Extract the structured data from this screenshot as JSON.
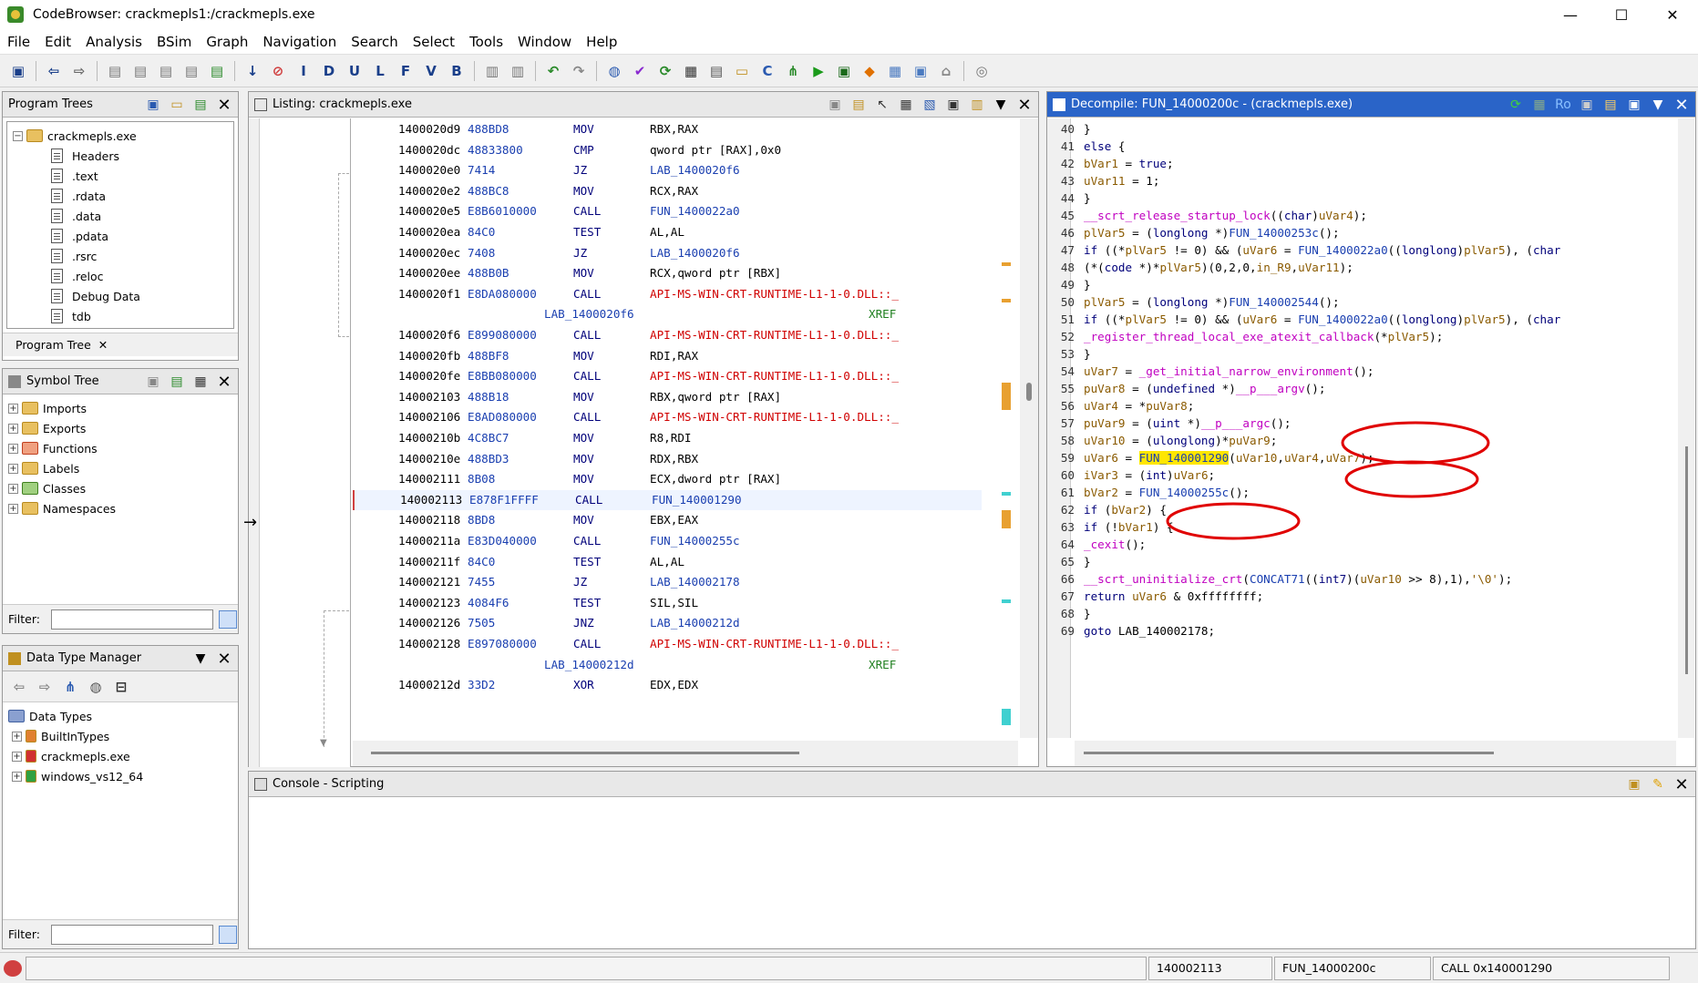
{
  "window": {
    "title": "CodeBrowser: crackmepls1:/crackmepls.exe",
    "controls": [
      "—",
      "☐",
      "✕"
    ]
  },
  "menu": [
    "File",
    "Edit",
    "Analysis",
    "BSim",
    "Graph",
    "Navigation",
    "Search",
    "Select",
    "Tools",
    "Window",
    "Help"
  ],
  "program_trees": {
    "title": "Program Trees",
    "root": "crackmepls.exe",
    "items": [
      "Headers",
      ".text",
      ".rdata",
      ".data",
      ".pdata",
      ".rsrc",
      ".reloc",
      "Debug Data",
      "tdb"
    ],
    "tab": "Program Tree"
  },
  "symbol_tree": {
    "title": "Symbol Tree",
    "items": [
      "Imports",
      "Exports",
      "Functions",
      "Labels",
      "Classes",
      "Namespaces"
    ],
    "filter_label": "Filter:"
  },
  "data_type_manager": {
    "title": "Data Type Manager",
    "root": "Data Types",
    "items": [
      "BuiltInTypes",
      "crackmepls.exe",
      "windows_vs12_64"
    ],
    "filter_label": "Filter:"
  },
  "listing": {
    "title": "Listing:  crackmepls.exe",
    "rows": [
      {
        "addr": "1400020d9",
        "bytes": "488BD8",
        "mn": "MOV",
        "op": "RBX,RAX",
        "opk": "op"
      },
      {
        "addr": "1400020dc",
        "bytes": "48833800",
        "mn": "CMP",
        "op": "qword ptr [RAX],0x0",
        "opk": "op"
      },
      {
        "addr": "1400020e0",
        "bytes": "7414",
        "mn": "JZ",
        "op": "LAB_1400020f6",
        "opk": "lab"
      },
      {
        "addr": "1400020e2",
        "bytes": "488BC8",
        "mn": "MOV",
        "op": "RCX,RAX",
        "opk": "op"
      },
      {
        "addr": "1400020e5",
        "bytes": "E8B6010000",
        "mn": "CALL",
        "op": "FUN_1400022a0",
        "opk": "lab"
      },
      {
        "addr": "1400020ea",
        "bytes": "84C0",
        "mn": "TEST",
        "op": "AL,AL",
        "opk": "op"
      },
      {
        "addr": "1400020ec",
        "bytes": "7408",
        "mn": "JZ",
        "op": "LAB_1400020f6",
        "opk": "lab"
      },
      {
        "addr": "1400020ee",
        "bytes": "488B0B",
        "mn": "MOV",
        "op": "RCX,qword ptr [RBX]",
        "opk": "op"
      },
      {
        "addr": "1400020f1",
        "bytes": "E8DA080000",
        "mn": "CALL",
        "op": "API-MS-WIN-CRT-RUNTIME-L1-1-0.DLL::_",
        "opk": "api"
      },
      {
        "label": "LAB_1400020f6",
        "xref": "XREF"
      },
      {
        "addr": "1400020f6",
        "bytes": "E899080000",
        "mn": "CALL",
        "op": "API-MS-WIN-CRT-RUNTIME-L1-1-0.DLL::_",
        "opk": "api"
      },
      {
        "addr": "1400020fb",
        "bytes": "488BF8",
        "mn": "MOV",
        "op": "RDI,RAX",
        "opk": "op"
      },
      {
        "addr": "1400020fe",
        "bytes": "E8BB080000",
        "mn": "CALL",
        "op": "API-MS-WIN-CRT-RUNTIME-L1-1-0.DLL::_",
        "opk": "api"
      },
      {
        "addr": "140002103",
        "bytes": "488B18",
        "mn": "MOV",
        "op": "RBX,qword ptr [RAX]",
        "opk": "op"
      },
      {
        "addr": "140002106",
        "bytes": "E8AD080000",
        "mn": "CALL",
        "op": "API-MS-WIN-CRT-RUNTIME-L1-1-0.DLL::_",
        "opk": "api"
      },
      {
        "addr": "14000210b",
        "bytes": "4C8BC7",
        "mn": "MOV",
        "op": "R8,RDI",
        "opk": "op"
      },
      {
        "addr": "14000210e",
        "bytes": "488BD3",
        "mn": "MOV",
        "op": "RDX,RBX",
        "opk": "op"
      },
      {
        "addr": "140002111",
        "bytes": "8B08",
        "mn": "MOV",
        "op": "ECX,dword ptr [RAX]",
        "opk": "op"
      },
      {
        "addr": "140002113",
        "bytes": "E878F1FFFF",
        "mn": "CALL",
        "op": "FUN_140001290",
        "opk": "lab",
        "current": true
      },
      {
        "addr": "140002118",
        "bytes": "8BD8",
        "mn": "MOV",
        "op": "EBX,EAX",
        "opk": "op"
      },
      {
        "addr": "14000211a",
        "bytes": "E83D040000",
        "mn": "CALL",
        "op": "FUN_14000255c",
        "opk": "lab"
      },
      {
        "addr": "14000211f",
        "bytes": "84C0",
        "mn": "TEST",
        "op": "AL,AL",
        "opk": "op"
      },
      {
        "addr": "140002121",
        "bytes": "7455",
        "mn": "JZ",
        "op": "LAB_140002178",
        "opk": "lab"
      },
      {
        "addr": "140002123",
        "bytes": "4084F6",
        "mn": "TEST",
        "op": "SIL,SIL",
        "opk": "op"
      },
      {
        "addr": "140002126",
        "bytes": "7505",
        "mn": "JNZ",
        "op": "LAB_14000212d",
        "opk": "lab"
      },
      {
        "addr": "140002128",
        "bytes": "E897080000",
        "mn": "CALL",
        "op": "API-MS-WIN-CRT-RUNTIME-L1-1-0.DLL::_",
        "opk": "api"
      },
      {
        "label": "LAB_14000212d",
        "xref": "XREF"
      },
      {
        "addr": "14000212d",
        "bytes": "33D2",
        "mn": "XOR",
        "op": "EDX,EDX",
        "opk": "op"
      }
    ]
  },
  "decompile": {
    "title": "Decompile: FUN_14000200c -  (crackmepls.exe)",
    "lines": [
      {
        "n": "40",
        "html": "  }"
      },
      {
        "n": "41",
        "html": "  <span class='k'>else</span> {"
      },
      {
        "n": "42",
        "html": "    <span class='v'>bVar1</span> = <span class='k'>true</span>;"
      },
      {
        "n": "43",
        "html": "    <span class='v'>uVar11</span> = 1;"
      },
      {
        "n": "44",
        "html": "  }"
      },
      {
        "n": "45",
        "html": "  <span class='fm'>__scrt_release_startup_lock</span>((<span class='t'>char</span>)<span class='v'>uVar4</span>);"
      },
      {
        "n": "46",
        "html": "  <span class='v'>plVar5</span> = (<span class='t'>longlong</span> *)<span class='f'>FUN_14000253c</span>();"
      },
      {
        "n": "47",
        "html": "  <span class='k'>if</span> ((*<span class='v'>plVar5</span> != 0) &amp;&amp; (<span class='v'>uVar6</span> = <span class='f'>FUN_1400022a0</span>((<span class='t'>longlong</span>)<span class='v'>plVar5</span>), (<span class='t'>char</span>"
      },
      {
        "n": "48",
        "html": "    (*(<span class='t'>code</span> *)*<span class='v'>plVar5</span>)(0,2,0,<span class='v'>in_R9</span>,<span class='v'>uVar11</span>);"
      },
      {
        "n": "49",
        "html": "  }"
      },
      {
        "n": "50",
        "html": "  <span class='v'>plVar5</span> = (<span class='t'>longlong</span> *)<span class='f'>FUN_140002544</span>();"
      },
      {
        "n": "51",
        "html": "  <span class='k'>if</span> ((*<span class='v'>plVar5</span> != 0) &amp;&amp; (<span class='v'>uVar6</span> = <span class='f'>FUN_1400022a0</span>((<span class='t'>longlong</span>)<span class='v'>plVar5</span>), (<span class='t'>char</span>"
      },
      {
        "n": "52",
        "html": "    <span class='fm'>_register_thread_local_exe_atexit_callback</span>(*<span class='v'>plVar5</span>);"
      },
      {
        "n": "53",
        "html": "  }"
      },
      {
        "n": "54",
        "html": "  <span class='v'>uVar7</span> = <span class='fm'>_get_initial_narrow_environment</span>();"
      },
      {
        "n": "55",
        "html": "  <span class='v'>puVar8</span> = (<span class='t'>undefined</span> *)<span class='fm'>__p___argv</span>();"
      },
      {
        "n": "56",
        "html": "  <span class='v'>uVar4</span> = *<span class='v'>puVar8</span>;"
      },
      {
        "n": "57",
        "html": "  <span class='v'>puVar9</span> = (<span class='t'>uint</span> *)<span class='fm'>__p___argc</span>();"
      },
      {
        "n": "58",
        "html": "  <span class='v'>uVar10</span> = (<span class='t'>ulonglong</span>)*<span class='v'>puVar9</span>;"
      },
      {
        "n": "59",
        "html": "  <span class='v'>uVar6</span> = <span class='f hl'>FUN_140001290</span>(<span class='v'>uVar10</span>,<span class='v'>uVar4</span>,<span class='v'>uVar7</span>);"
      },
      {
        "n": "60",
        "html": "  <span class='v'>iVar3</span> = (<span class='t'>int</span>)<span class='v'>uVar6</span>;"
      },
      {
        "n": "61",
        "html": "  <span class='v'>bVar2</span> = <span class='f'>FUN_14000255c</span>();"
      },
      {
        "n": "62",
        "html": "  <span class='k'>if</span> (<span class='v'>bVar2</span>) {"
      },
      {
        "n": "63",
        "html": "    <span class='k'>if</span> (!<span class='v'>bVar1</span>) {"
      },
      {
        "n": "64",
        "html": "      <span class='fm'>_cexit</span>();"
      },
      {
        "n": "65",
        "html": "    }"
      },
      {
        "n": "66",
        "html": "    <span class='fm'>__scrt_uninitialize_crt</span>(<span class='f'>CONCAT71</span>((<span class='t'>int7</span>)(<span class='v'>uVar10</span> &gt;&gt; 8),1),<span class='v'>'\\0'</span>);"
      },
      {
        "n": "67",
        "html": "    <span class='k'>return</span> <span class='v'>uVar6</span> &amp; 0xffffffff;"
      },
      {
        "n": "68",
        "html": "  }"
      },
      {
        "n": "69",
        "html": "  <span class='k'>goto</span> LAB_140002178;"
      }
    ]
  },
  "console": {
    "title": "Console - Scripting"
  },
  "status": {
    "address": "140002113",
    "function": "FUN_14000200c",
    "instruction": "CALL 0x140001290"
  }
}
